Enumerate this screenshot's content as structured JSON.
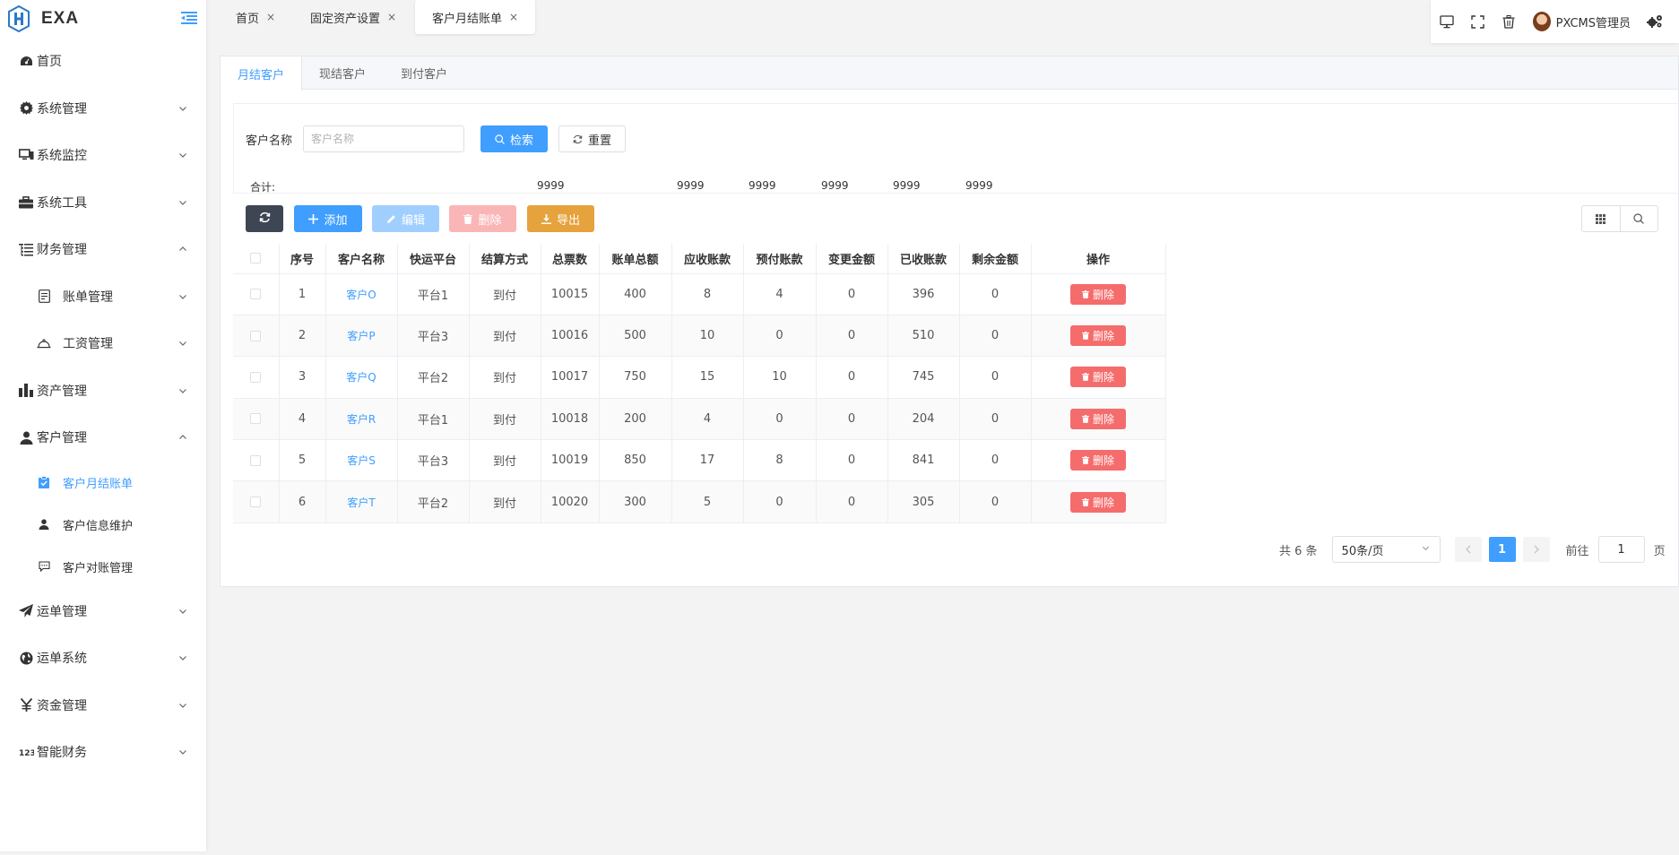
{
  "app": {
    "logo_text": "EXA"
  },
  "sidebar": {
    "items": [
      {
        "label": "首页",
        "icon": "dashboard-icon",
        "expanded": null
      },
      {
        "label": "系统管理",
        "icon": "gear-icon",
        "expanded": false
      },
      {
        "label": "系统监控",
        "icon": "monitor-icon",
        "expanded": false
      },
      {
        "label": "系统工具",
        "icon": "toolbox-icon",
        "expanded": false
      },
      {
        "label": "财务管理",
        "icon": "tree-list-icon",
        "expanded": true
      },
      {
        "label": "账单管理",
        "icon": "document-icon",
        "expanded": false
      },
      {
        "label": "工资管理",
        "icon": "bell-icon",
        "expanded": false
      },
      {
        "label": "资产管理",
        "icon": "bar-chart-icon",
        "expanded": false
      },
      {
        "label": "客户管理",
        "icon": "user-icon",
        "expanded": true
      },
      {
        "label": "客户月结账单",
        "icon": "clipboard-check-icon",
        "active": true
      },
      {
        "label": "客户信息维护",
        "icon": "user-small-icon"
      },
      {
        "label": "客户对账管理",
        "icon": "chat-icon"
      },
      {
        "label": "运单管理",
        "icon": "send-icon",
        "expanded": false
      },
      {
        "label": "运单系统",
        "icon": "globe-icon",
        "expanded": false
      },
      {
        "label": "资金管理",
        "icon": "yen-icon",
        "expanded": false
      },
      {
        "label": "智能财务",
        "icon": "number-icon",
        "expanded": false
      }
    ]
  },
  "tabs": [
    {
      "label": "首页"
    },
    {
      "label": "固定资产设置"
    },
    {
      "label": "客户月结账单",
      "active": true
    }
  ],
  "topbar": {
    "username": "PXCMS管理员"
  },
  "subtabs": [
    {
      "label": "月结客户",
      "active": true
    },
    {
      "label": "现结客户"
    },
    {
      "label": "到付客户"
    }
  ],
  "search": {
    "label": "客户名称",
    "placeholder": "客户名称",
    "value": "",
    "search_label": "检索",
    "reset_label": "重置"
  },
  "summary": {
    "label": "合计:",
    "values": [
      "9999",
      "9999",
      "9999",
      "9999",
      "9999",
      "9999"
    ]
  },
  "actions": {
    "add": "添加",
    "edit": "编辑",
    "delete": "删除",
    "export": "导出"
  },
  "table": {
    "headers": [
      "序号",
      "客户名称",
      "快运平台",
      "结算方式",
      "总票数",
      "账单总额",
      "应收账款",
      "预付账款",
      "变更金额",
      "已收账款",
      "剩余金额",
      "操作"
    ],
    "delete_label": "删除",
    "rows": [
      [
        "1",
        "客户O",
        "平台1",
        "到付",
        "10015",
        "400",
        "8",
        "4",
        "0",
        "396",
        "0"
      ],
      [
        "2",
        "客户P",
        "平台3",
        "到付",
        "10016",
        "500",
        "10",
        "0",
        "0",
        "510",
        "0"
      ],
      [
        "3",
        "客户Q",
        "平台2",
        "到付",
        "10017",
        "750",
        "15",
        "10",
        "0",
        "745",
        "0"
      ],
      [
        "4",
        "客户R",
        "平台1",
        "到付",
        "10018",
        "200",
        "4",
        "0",
        "0",
        "204",
        "0"
      ],
      [
        "5",
        "客户S",
        "平台3",
        "到付",
        "10019",
        "850",
        "17",
        "8",
        "0",
        "841",
        "0"
      ],
      [
        "6",
        "客户T",
        "平台2",
        "到付",
        "10020",
        "300",
        "5",
        "0",
        "0",
        "305",
        "0"
      ]
    ]
  },
  "pagination": {
    "total": "共 6 条",
    "page_size": "50条/页",
    "current": "1",
    "goto_label": "前往",
    "goto_value": "1",
    "page_suffix": "页"
  },
  "colors": {
    "primary": "#409eff",
    "danger": "#f56c6c",
    "warning": "#e6a23c",
    "dark": "#3d4652"
  }
}
